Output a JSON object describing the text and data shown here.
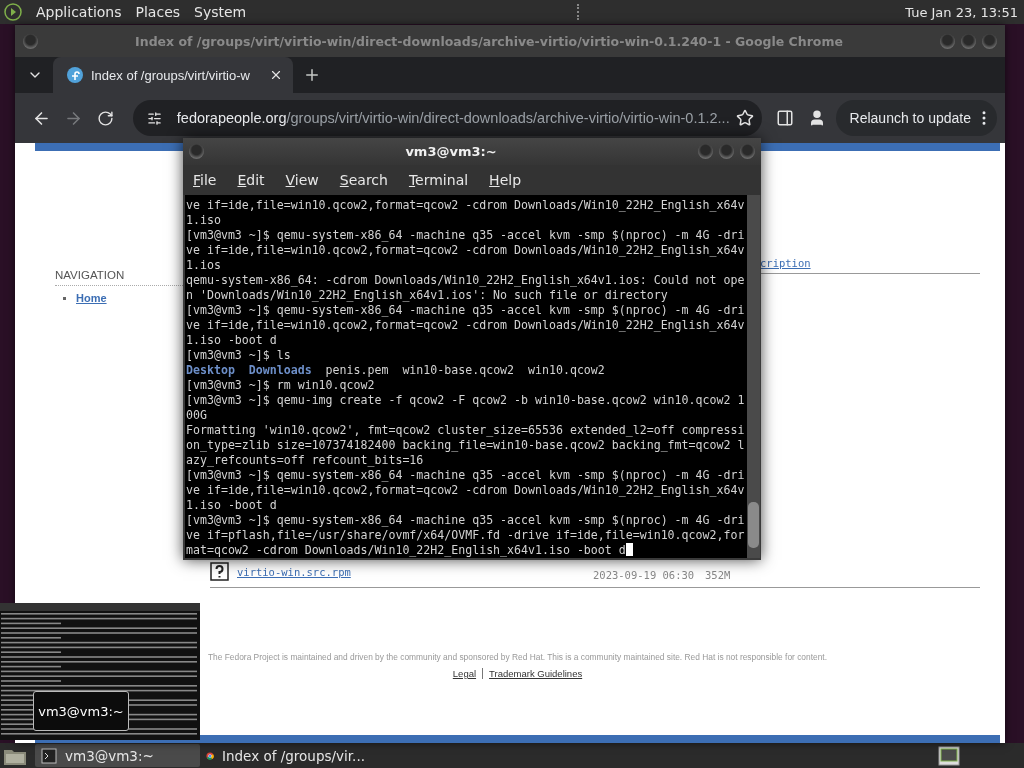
{
  "top_panel": {
    "menus": [
      "Applications",
      "Places",
      "System"
    ],
    "clock": "Tue Jan 23, 13:51"
  },
  "browser": {
    "title": "Index of /groups/virt/virtio-win/direct-downloads/archive-virtio/virtio-win-0.1.240-1 - Google Chrome",
    "tabs": [
      {
        "title": "Index of /groups/virt/virtio-w",
        "selected": true
      }
    ],
    "nav_buttons": [
      {
        "kind": "back",
        "disabled": false
      },
      {
        "kind": "forward",
        "disabled": true
      },
      {
        "kind": "reload",
        "disabled": false
      }
    ],
    "address": {
      "host": "fedorapeople.org",
      "path": "/groups/virt/virtio-win/direct-downloads/archive-virtio/virtio-win-0.1.2..."
    },
    "relaunch_button": "Relaunch to update",
    "page": {
      "navigation": {
        "heading": "NAVIGATION",
        "links": [
          "Home"
        ]
      },
      "column_header": "cription",
      "rows": [
        {
          "name": "virtio-win.src.rpm",
          "modified": "2023-09-19 06:30",
          "size": "352M"
        }
      ],
      "footer": {
        "text": "The Fedora Project is maintained and driven by the community and sponsored by Red Hat. This is a community maintained site. Red Hat is not responsible for content.",
        "links": [
          "Legal",
          "Trademark Guidelines"
        ]
      }
    }
  },
  "terminal": {
    "title": "vm3@vm3:~",
    "menu": [
      "File",
      "Edit",
      "View",
      "Search",
      "Terminal",
      "Help"
    ],
    "lines": [
      {
        "kind": "text",
        "text": "ve if=ide,file=win10.qcow2,format=qcow2 -cdrom Downloads/Win10_22H2_English_x64v"
      },
      {
        "kind": "text",
        "text": "1.iso"
      },
      {
        "kind": "text",
        "text": "[vm3@vm3 ~]$ qemu-system-x86_64 -machine q35 -accel kvm -smp $(nproc) -m 4G -dri"
      },
      {
        "kind": "text",
        "text": "ve if=ide,file=win10.qcow2,format=qcow2 -cdrom Downloads/Win10_22H2_English_x64v"
      },
      {
        "kind": "text",
        "text": "1.ios"
      },
      {
        "kind": "text",
        "text": "qemu-system-x86_64: -cdrom Downloads/Win10_22H2_English_x64v1.ios: Could not ope"
      },
      {
        "kind": "text",
        "text": "n 'Downloads/Win10_22H2_English_x64v1.ios': No such file or directory"
      },
      {
        "kind": "text",
        "text": "[vm3@vm3 ~]$ qemu-system-x86_64 -machine q35 -accel kvm -smp $(nproc) -m 4G -dri"
      },
      {
        "kind": "text",
        "text": "ve if=ide,file=win10.qcow2,format=qcow2 -cdrom Downloads/Win10_22H2_English_x64v"
      },
      {
        "kind": "text",
        "text": "1.iso -boot d"
      },
      {
        "kind": "text",
        "text": "[vm3@vm3 ~]$ ls"
      },
      {
        "kind": "listing",
        "items": [
          {
            "name": "Desktop",
            "kind": "dir"
          },
          {
            "name": "Downloads",
            "kind": "dir"
          },
          {
            "name": "penis.pem",
            "kind": "file"
          },
          {
            "name": "win10-base.qcow2",
            "kind": "file"
          },
          {
            "name": "win10.qcow2",
            "kind": "file"
          }
        ]
      },
      {
        "kind": "text",
        "text": "[vm3@vm3 ~]$ rm win10.qcow2"
      },
      {
        "kind": "text",
        "text": "[vm3@vm3 ~]$ qemu-img create -f qcow2 -F qcow2 -b win10-base.qcow2 win10.qcow2 1"
      },
      {
        "kind": "text",
        "text": "00G"
      },
      {
        "kind": "text",
        "text": "Formatting 'win10.qcow2', fmt=qcow2 cluster_size=65536 extended_l2=off compressi"
      },
      {
        "kind": "text",
        "text": "on_type=zlib size=107374182400 backing_file=win10-base.qcow2 backing_fmt=qcow2 l"
      },
      {
        "kind": "text",
        "text": "azy_refcounts=off refcount_bits=16"
      },
      {
        "kind": "text",
        "text": "[vm3@vm3 ~]$ qemu-system-x86_64 -machine q35 -accel kvm -smp $(nproc) -m 4G -dri"
      },
      {
        "kind": "text",
        "text": "ve if=ide,file=win10.qcow2,format=qcow2 -cdrom Downloads/Win10_22H2_English_x64v"
      },
      {
        "kind": "text",
        "text": "1.iso -boot d"
      },
      {
        "kind": "text",
        "text": "[vm3@vm3 ~]$ qemu-system-x86_64 -machine q35 -accel kvm -smp $(nproc) -m 4G -dri"
      },
      {
        "kind": "text",
        "text": "ve if=pflash,file=/usr/share/ovmf/x64/OVMF.fd -drive if=ide,file=win10.qcow2,for"
      },
      {
        "kind": "text",
        "text": "mat=qcow2 -cdrom Downloads/Win10_22H2_English_x64v1.iso -boot d",
        "cursor": true
      }
    ]
  },
  "preview": {
    "tooltip": "vm3@vm3:~"
  },
  "taskbar": {
    "tasks": [
      {
        "label": "vm3@vm3:~",
        "kind": "terminal",
        "selected": true
      },
      {
        "label": "Index of /groups/vir...",
        "kind": "browser",
        "selected": false
      }
    ]
  }
}
